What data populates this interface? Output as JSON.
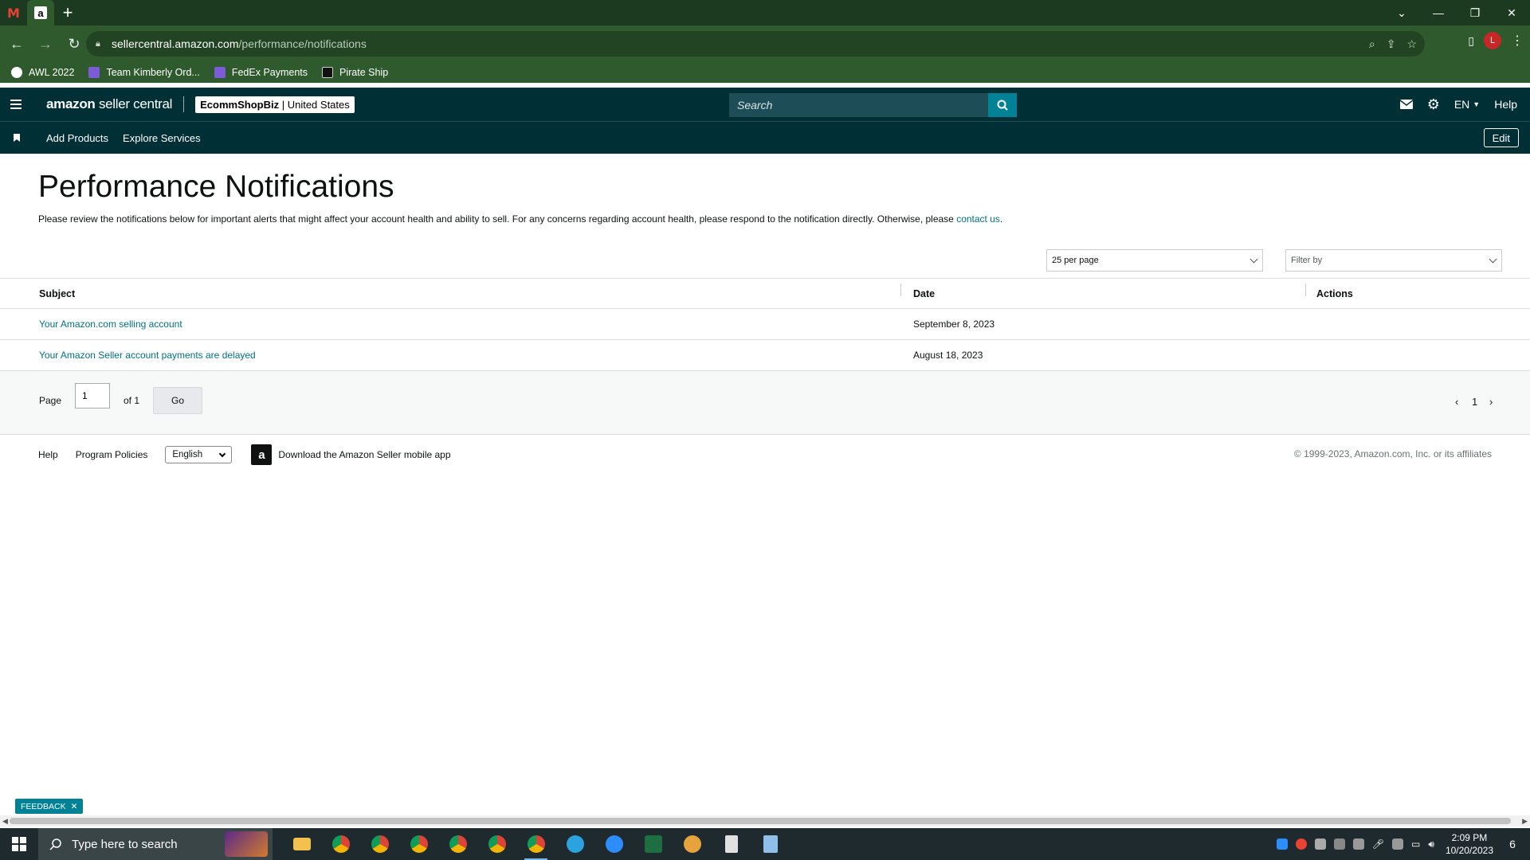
{
  "browser": {
    "url_host": "sellercentral.amazon.com",
    "url_path": "/performance/notifications",
    "profile_initial": "L",
    "bookmarks": [
      "AWL 2022",
      "Team Kimberly Ord...",
      "FedEx Payments",
      "Pirate Ship"
    ]
  },
  "header": {
    "logo_brand": "amazon",
    "logo_product": "seller central",
    "store_name": "EcommShopBiz",
    "store_region": "| United States",
    "search_placeholder": "Search",
    "language": "EN",
    "help_label": "Help"
  },
  "subnav": {
    "links": [
      "Add Products",
      "Explore Services"
    ],
    "edit_label": "Edit"
  },
  "main": {
    "title": "Performance Notifications",
    "intro_text": "Please review the notifications below for important alerts that might affect your account health and ability to sell. For any concerns regarding account health, please respond to the notification directly. Otherwise, please ",
    "intro_link": "contact us",
    "intro_end": ".",
    "per_page": "25 per page",
    "filter_placeholder": "Filter by"
  },
  "table": {
    "columns": [
      "Subject",
      "Date",
      "Actions"
    ],
    "rows": [
      {
        "subject": "Your Amazon.com selling account",
        "date": "September 8, 2023",
        "actions": ""
      },
      {
        "subject": "Your Amazon Seller account payments are delayed",
        "date": "August 18, 2023",
        "actions": ""
      }
    ]
  },
  "pagination": {
    "page_label": "Page",
    "page_value": "1",
    "of_label": "of 1",
    "go_label": "Go",
    "current_page": "1"
  },
  "footer": {
    "help": "Help",
    "program_policies": "Program Policies",
    "language_select": "English",
    "app_text": "Download the Amazon Seller mobile app",
    "copyright": "© 1999-2023, Amazon.com, Inc. or its affiliates"
  },
  "feedback": {
    "label": "FEEDBACK"
  },
  "taskbar": {
    "search_placeholder": "Type here to search",
    "time": "2:09 PM",
    "date": "10/20/2023",
    "notification_count": "6"
  }
}
